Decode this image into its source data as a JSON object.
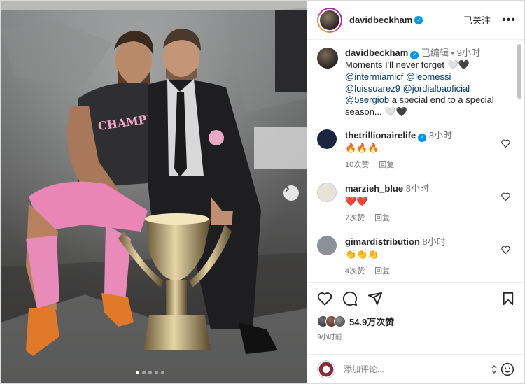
{
  "colors": {
    "verified": "#0095f6",
    "link": "#00376b",
    "muted": "#737373",
    "like_red": "#ed4956"
  },
  "media": {
    "carousel_count": 5,
    "active_index": 0,
    "next_icon": "chevron-right-icon"
  },
  "header": {
    "username": "davidbeckham",
    "follow_label": "已关注",
    "more_icon": "ellipsis-icon"
  },
  "caption": {
    "username": "davidbeckham",
    "edited": "已编辑",
    "separator": "•",
    "time": "9小时",
    "text1": "Moments I'll never forget 🤍🖤",
    "mention1": "@intermiamicf",
    "mention2": "@leomessi",
    "mention3": "@luissuarez9",
    "mention4": "@jordialbaoficial",
    "mention5": "@5sergiob",
    "text2": "a special end to a special season... 🤍🖤"
  },
  "comments": [
    {
      "username": "thetrillionairelife",
      "verified": true,
      "time": "3小时",
      "text": "🔥🔥🔥",
      "likes": "10次赞",
      "reply": "回复"
    },
    {
      "username": "marzieh_blue",
      "verified": false,
      "time": "8小时",
      "text": "❤️❤️",
      "likes": "7次赞",
      "reply": "回复"
    },
    {
      "username": "gimardistribution",
      "verified": false,
      "time": "8小时",
      "text": "👏👏👏",
      "likes": "4次赞",
      "reply": "回复"
    }
  ],
  "actions": {
    "like_icon": "heart-icon",
    "comment_icon": "comment-icon",
    "share_icon": "share-icon",
    "save_icon": "bookmark-icon"
  },
  "likes": "54.9万次赞",
  "posted": "9小时前",
  "add_comment": {
    "placeholder": "添加评论..."
  }
}
